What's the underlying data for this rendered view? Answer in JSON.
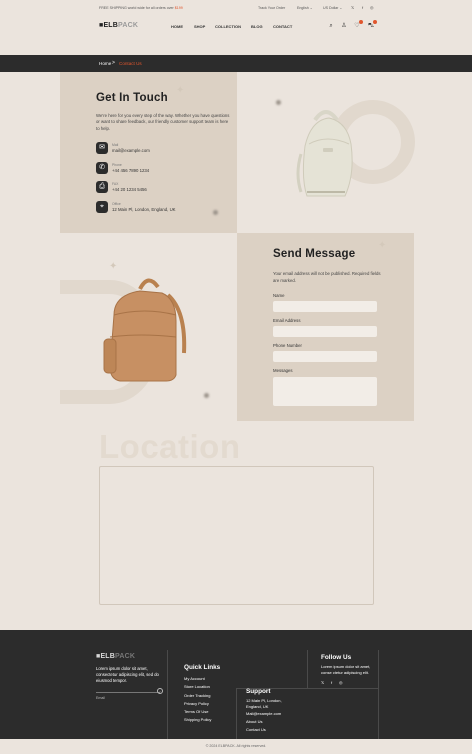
{
  "topbar": {
    "promo_prefix": "FREE SHIPPING world wide for all orders over",
    "promo_amount": "$199",
    "track_order": "Track Your Order",
    "language": "English",
    "currency": "US Dollar",
    "social_icons": [
      "x-icon",
      "facebook-icon",
      "instagram-icon"
    ]
  },
  "header": {
    "logo_main": "ELB",
    "logo_sub": "PACK",
    "nav": [
      "HOME",
      "SHOP",
      "COLLECTION",
      "BLOG",
      "CONTACT"
    ]
  },
  "breadcrumb": {
    "home": "Home",
    "separator": ">",
    "current": "Contact Us"
  },
  "get_in_touch": {
    "title": "Get In Touch",
    "description": "We're here for you every step of the way. Whether you have questions or want to share feedback, our friendly customer support team is here to help.",
    "items": [
      {
        "icon": "mail-icon",
        "label": "Mail",
        "value": "mail@example.com"
      },
      {
        "icon": "phone-icon",
        "label": "Phone",
        "value": "+44 456 7890 1234"
      },
      {
        "icon": "fax-icon",
        "label": "FAX",
        "value": "+44 20 1234 5456"
      },
      {
        "icon": "location-icon",
        "label": "Office",
        "value": "12 Main Pl, London, England, UK"
      }
    ]
  },
  "send_message": {
    "title": "Send Message",
    "description": "Your email address will not be published. Required fields are marked.",
    "fields": [
      {
        "label": "Name"
      },
      {
        "label": "Email Address"
      },
      {
        "label": "Phone Number"
      },
      {
        "label": "Messages"
      }
    ]
  },
  "location": {
    "title": "Location"
  },
  "footer": {
    "logo_main": "ELB",
    "logo_sub": "PACK",
    "description": "Lorem ipsum dolor sit amet, consectetur adipiscing elit, sed do eiusmod tempor.",
    "email_label": "Email",
    "quick_links_title": "Quick Links",
    "quick_links": [
      "My Account",
      "Store Location",
      "Order Tracking",
      "Privacy Policy",
      "Terms Of Use",
      "Shipping Policy"
    ],
    "support_title": "Support",
    "support_address": "12 Main Pl, London, England, UK",
    "support_items": [
      "Mail@example.com",
      "About Us",
      "Contact Us"
    ],
    "follow_title": "Follow Us",
    "follow_desc": "Lorem ipsum dolor sit amet, conse ctetur adipiscing elit.",
    "social_icons": [
      "x-icon",
      "facebook-icon",
      "instagram-icon"
    ],
    "copyright": "© 2024 ELBPACK. All rights reserved."
  },
  "colors": {
    "background": "#ebe4dd",
    "panel": "#dcd1c4",
    "dark": "#2c2c2c",
    "accent": "#e0562d"
  }
}
